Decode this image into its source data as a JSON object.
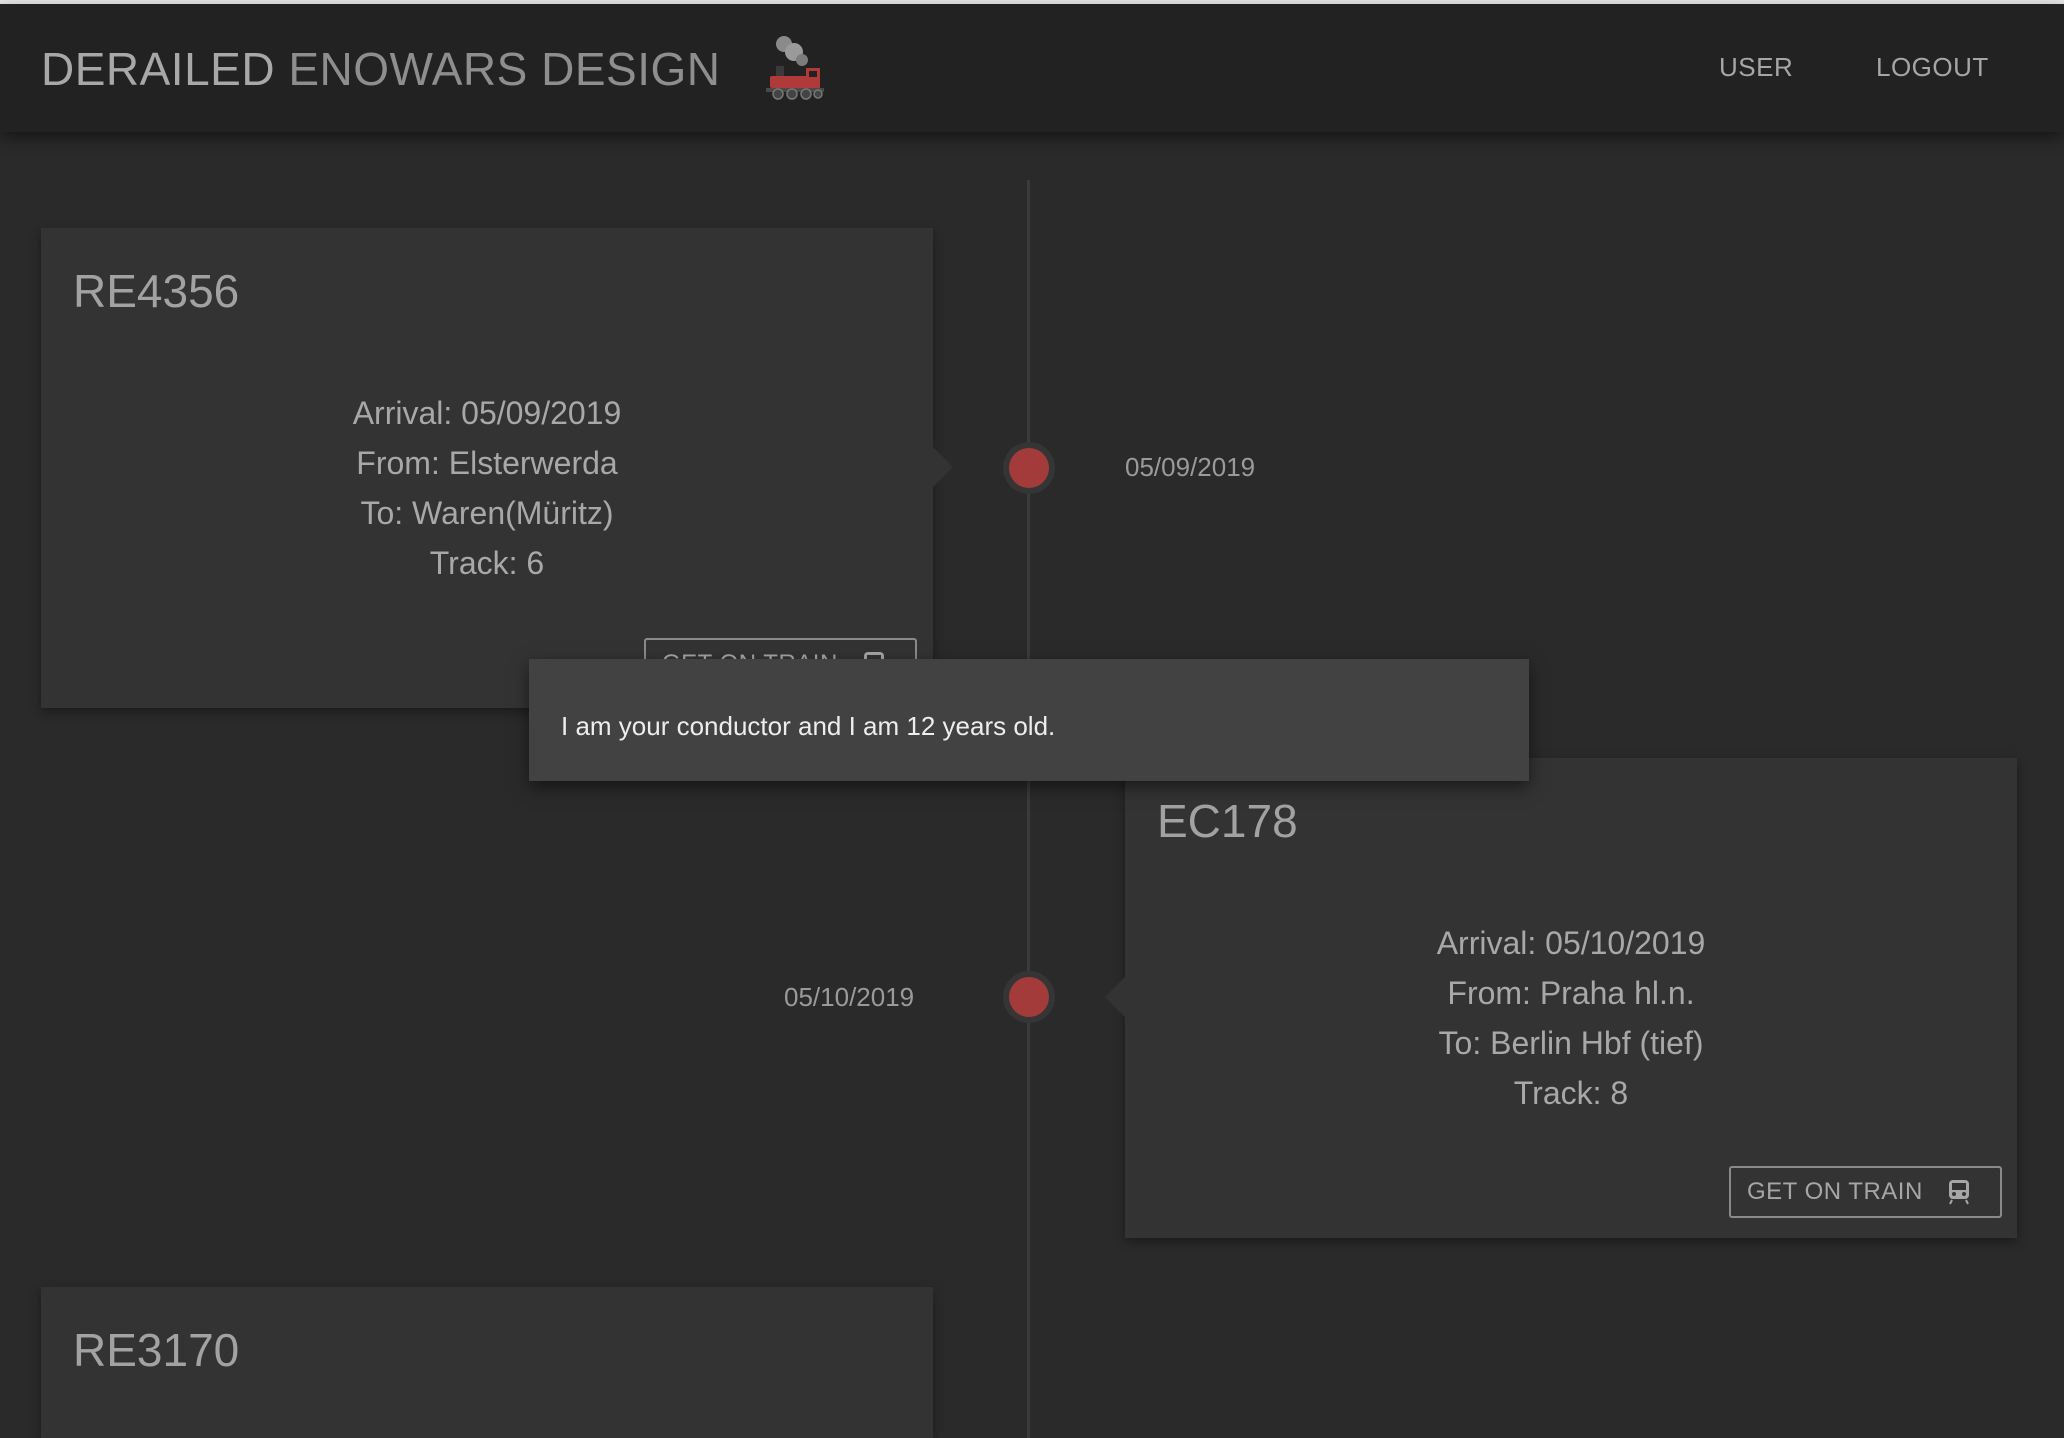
{
  "header": {
    "brand_strong": "DERAILED",
    "brand_light": "ENOWARS DESIGN",
    "logo_icon": "steam-locomotive-icon",
    "nav": [
      {
        "label": "USER"
      },
      {
        "label": "LOGOUT"
      }
    ]
  },
  "timeline": {
    "entries": [
      {
        "train": "RE4356",
        "date": "05/09/2019",
        "arrival": "Arrival: 05/09/2019",
        "from": "From: Elsterwerda",
        "to": "To: Waren(Müritz)",
        "track": "Track: 6",
        "button_label": "GET ON TRAIN"
      },
      {
        "train": "EC178",
        "date": "05/10/2019",
        "arrival": "Arrival: 05/10/2019",
        "from": "From: Praha hl.n.",
        "to": "To: Berlin Hbf (tief)",
        "track": "Track: 8",
        "button_label": "GET ON TRAIN"
      },
      {
        "train": "RE3170"
      }
    ]
  },
  "tooltip": {
    "text": "I am your conductor and I am 12 years old."
  },
  "colors": {
    "background": "#2a2a2a",
    "appbar": "#222222",
    "card": "#333333",
    "tooltip": "#424242",
    "accent_dot": "#a33b3b"
  }
}
